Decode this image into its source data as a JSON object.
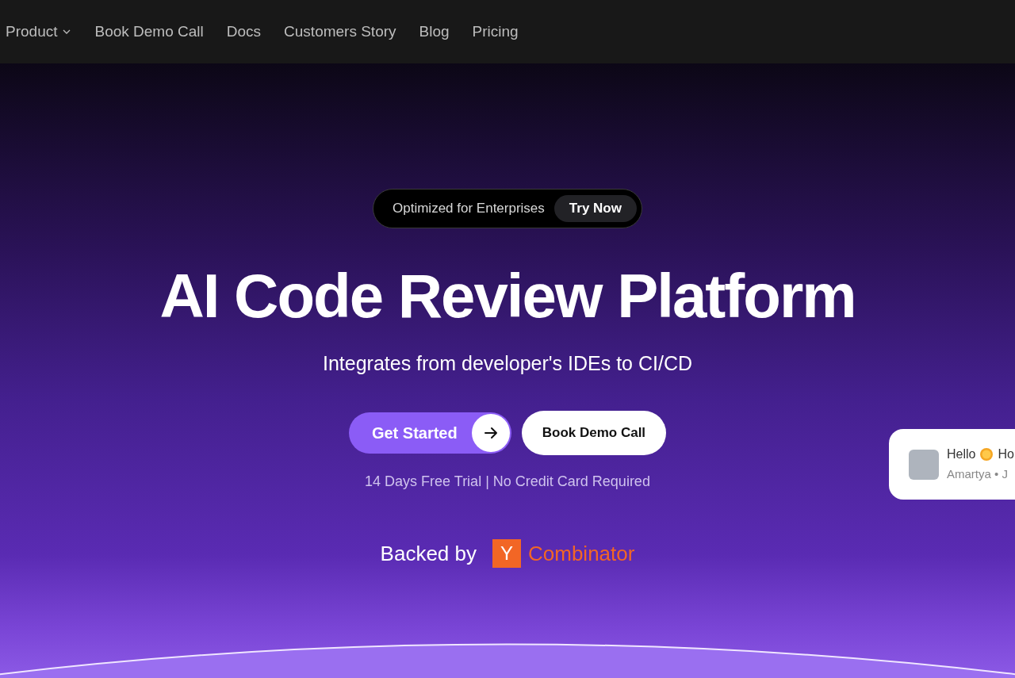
{
  "nav": {
    "items": [
      {
        "label": "Product",
        "dropdown": true
      },
      {
        "label": "Book Demo Call",
        "dropdown": false
      },
      {
        "label": "Docs",
        "dropdown": false
      },
      {
        "label": "Customers Story",
        "dropdown": false
      },
      {
        "label": "Blog",
        "dropdown": false
      },
      {
        "label": "Pricing",
        "dropdown": false
      }
    ]
  },
  "hero": {
    "pill": {
      "text": "Optimized for Enterprises",
      "button": "Try Now"
    },
    "title": "AI Code Review Platform",
    "subtitle": "Integrates from developer's IDEs to CI/CD",
    "primary_button": "Get Started",
    "secondary_button": "Book Demo Call",
    "note": "14 Days Free Trial | No Credit Card Required",
    "backed_by": "Backed by",
    "backer_logo_letter": "Y",
    "backer_name": "Combinator"
  },
  "chat_popup": {
    "greeting": "Hello",
    "greeting_cont": "Ho",
    "sender": "Amartya • J"
  }
}
